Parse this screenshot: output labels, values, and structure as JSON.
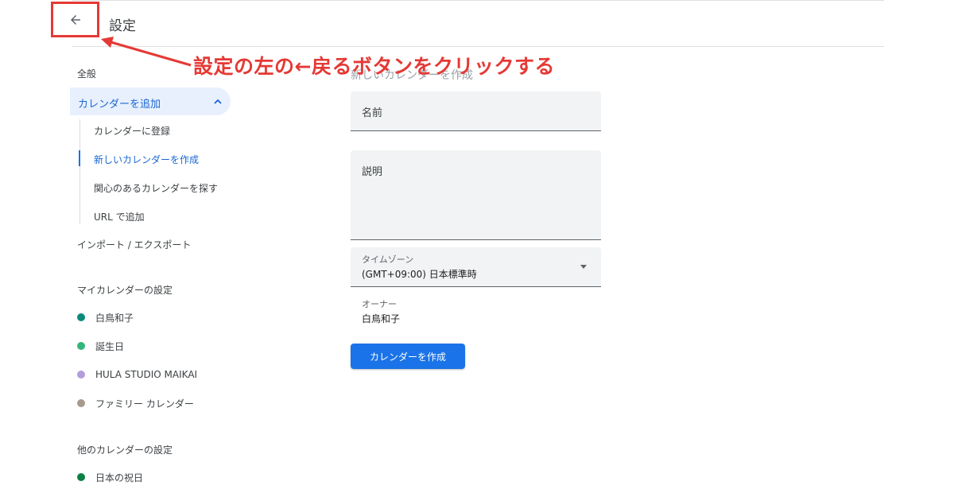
{
  "header": {
    "back_icon": "arrow-left-icon",
    "title": "設定"
  },
  "annotation": {
    "text": "設定の左の←戻るボタンをクリックする",
    "color": "#e53935"
  },
  "sidebar": {
    "general": "全般",
    "add_calendar": {
      "label": "カレンダーを追加",
      "icon": "chevron-up-icon",
      "items": [
        "カレンダーに登録",
        "新しいカレンダーを作成",
        "関心のあるカレンダーを探す",
        "URL で追加"
      ],
      "active_index": 1
    },
    "import_export": "インポート / エクスポート",
    "my_calendars": {
      "heading": "マイカレンダーの設定",
      "items": [
        {
          "name": "白鳥和子",
          "color": "#0b8a7a"
        },
        {
          "name": "誕生日",
          "color": "#33b679"
        },
        {
          "name": "HULA STUDIO MAIKAI",
          "color": "#b39ddb"
        },
        {
          "name": "ファミリー カレンダー",
          "color": "#a79b8e"
        }
      ]
    },
    "other_calendars": {
      "heading": "他のカレンダーの設定",
      "items": [
        {
          "name": "日本の祝日",
          "color": "#0b8043"
        }
      ]
    }
  },
  "form": {
    "heading": "新しいカレンダーを作成",
    "name_label": "名前",
    "description_label": "説明",
    "timezone_label": "タイムゾーン",
    "timezone_value": "(GMT+09:00) 日本標準時",
    "owner_label": "オーナー",
    "owner_value": "白鳥和子",
    "create_button": "カレンダーを作成"
  },
  "colors": {
    "accent": "#1a73e8",
    "active_bg": "#e8f0fe",
    "annotation": "#e53935"
  }
}
